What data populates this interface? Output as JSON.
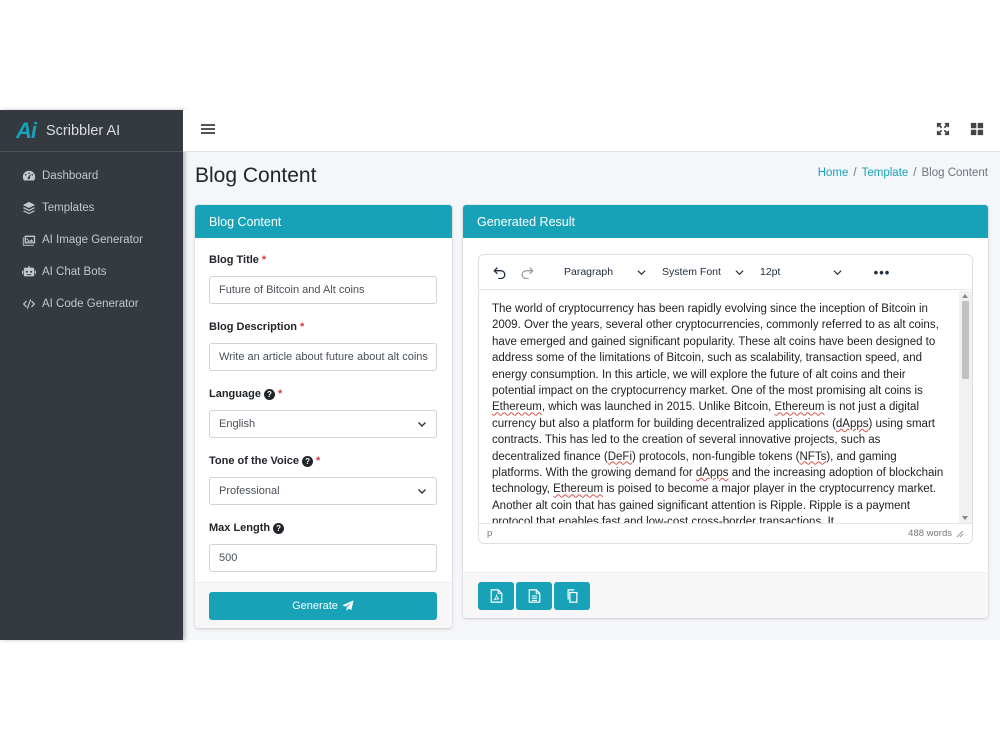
{
  "brand": {
    "logo_text": "Ai",
    "name": "Scribbler AI"
  },
  "sidebar": {
    "items": [
      {
        "label": "Dashboard",
        "icon": "dashboard-icon"
      },
      {
        "label": "Templates",
        "icon": "layers-icon"
      },
      {
        "label": "AI Image Generator",
        "icon": "image-icon"
      },
      {
        "label": "AI Chat Bots",
        "icon": "robot-icon"
      },
      {
        "label": "AI Code Generator",
        "icon": "code-icon"
      }
    ]
  },
  "topbar": {
    "menu_icon": "hamburger-icon",
    "right_icons": [
      "fullscreen-icon",
      "grid-icon"
    ]
  },
  "page": {
    "title": "Blog Content",
    "breadcrumb": {
      "home": "Home",
      "sep1": "/",
      "template": "Template",
      "sep2": "/",
      "current": "Blog Content"
    }
  },
  "form": {
    "header": "Blog Content",
    "blog_title_label": "Blog Title",
    "blog_title_value": "Future of Bitcoin and Alt coins",
    "blog_desc_label": "Blog Description",
    "blog_desc_value": "Write an article about future about alt coins",
    "language_label": "Language",
    "language_value": "English",
    "tone_label": "Tone of the Voice",
    "tone_value": "Professional",
    "max_length_label": "Max Length",
    "max_length_value": "500",
    "required_mark": "*",
    "help_mark": "?",
    "generate_label": "Generate"
  },
  "result": {
    "header": "Generated Result",
    "toolbar": {
      "block": "Paragraph",
      "font": "System Font",
      "size": "12pt",
      "more": "•••"
    },
    "text": {
      "t1": "The world of cryptocurrency has been rapidly evolving since the inception of Bitcoin in 2009. Over the years, several other cryptocurrencies, commonly referred to as alt coins, have emerged and gained significant popularity. These alt coins have been designed to address some of the limitations of Bitcoin, such as scalability, transaction speed, and energy consumption. In this article, we will explore the future of alt coins and their potential impact on the cryptocurrency market. One of the most promising alt coins is ",
      "w1": "Ethereum",
      "t2": ", which was launched in 2015. Unlike Bitcoin, ",
      "w2": "Ethereum",
      "t3": " is not just a digital currency but also a platform for building decentralized applications (",
      "w3": "dApps",
      "t4": ") using smart contracts. This has led to the creation of several innovative projects, such as decentralized finance (",
      "w4": "DeFi",
      "t5": ") protocols, non-fungible tokens (",
      "w5": "NFTs",
      "t6": "), and gaming platforms. With the growing demand for ",
      "w6": "dApps",
      "t7": " and the increasing adoption of blockchain technology, ",
      "w7": "Ethereum",
      "t8": " is poised to become a major player in the cryptocurrency market. Another alt coin that has gained significant attention is Ripple. Ripple is a payment protocol that enables fast and low-cost cross-border transactions. It"
    },
    "status_path": "p",
    "word_count": "488 words",
    "actions": [
      "file-pdf-icon",
      "file-text-icon",
      "copy-icon"
    ]
  },
  "colors": {
    "accent": "#17a2b8",
    "sidebar_bg": "#343a40",
    "required": "#dc3545"
  }
}
